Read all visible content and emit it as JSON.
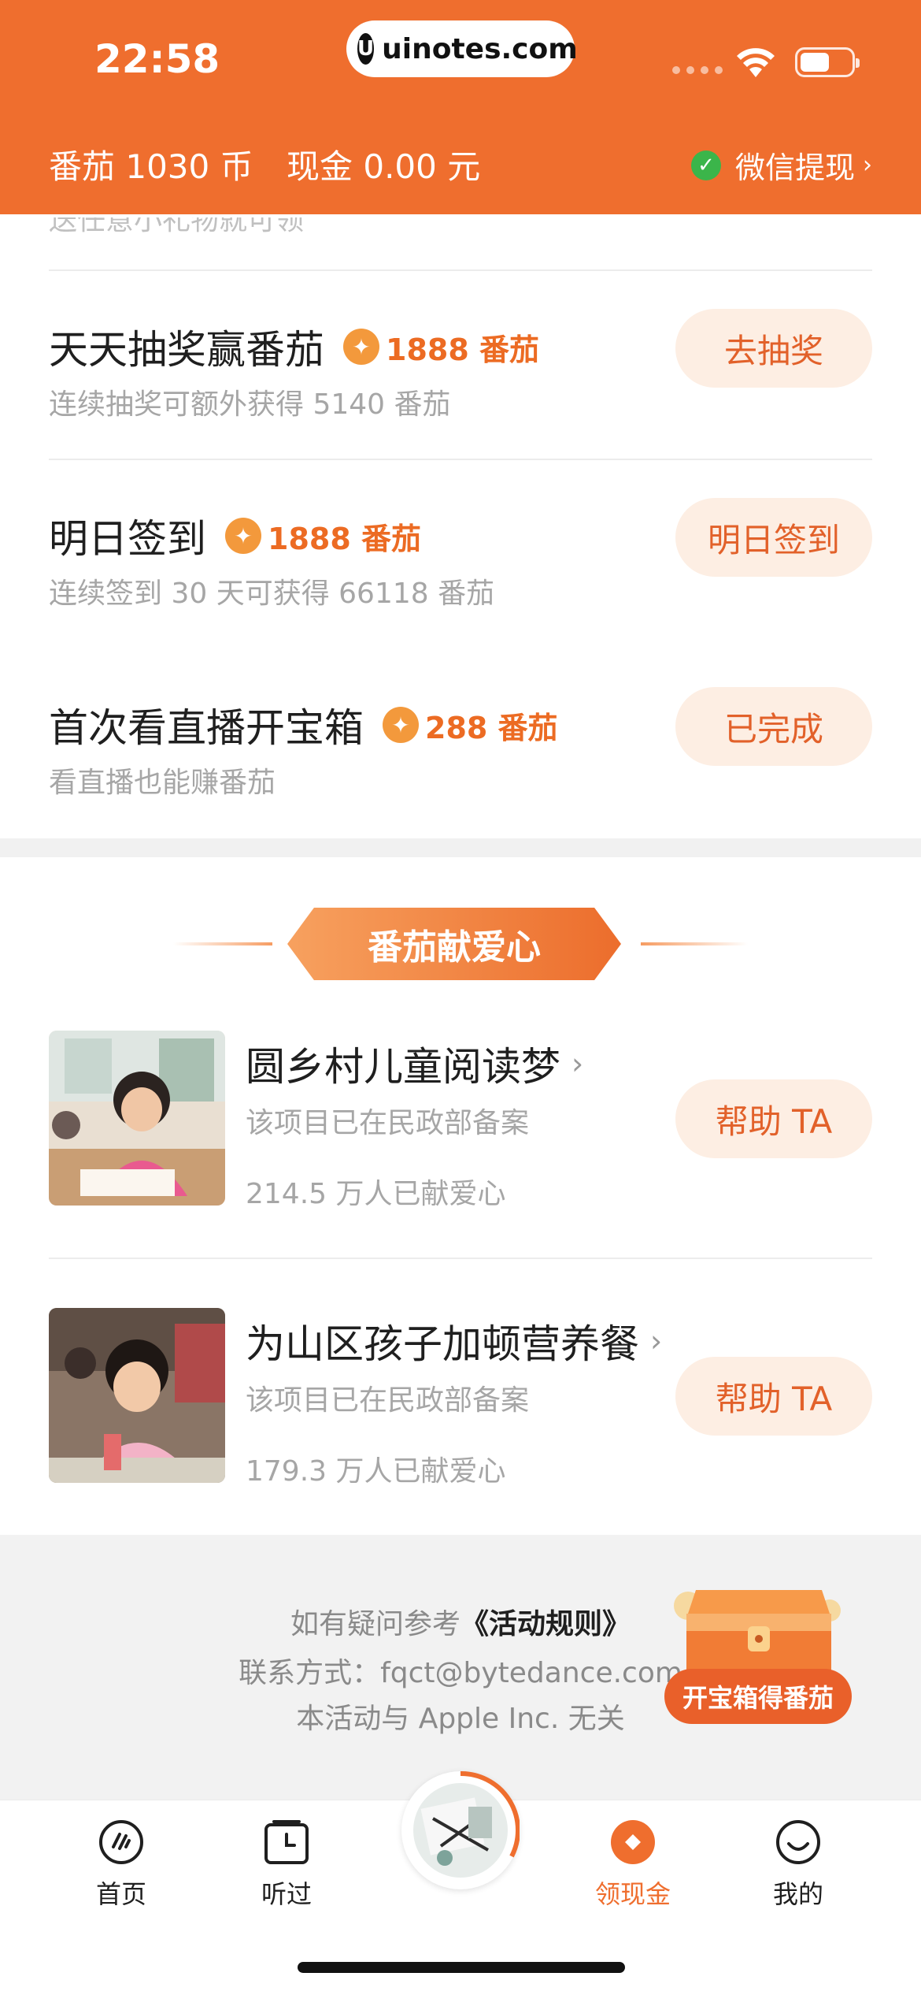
{
  "status_bar": {
    "time": "22:58",
    "url": "uinotes.com",
    "url_logo": "U"
  },
  "header": {
    "tomato_balance": "番茄 1030 币",
    "cash_balance": "现金 0.00 元",
    "wechat_withdraw": "微信提现",
    "chevron": "›"
  },
  "partial_text": "送任意小礼物就可领",
  "tasks": [
    {
      "title": "天天抽奖赢番茄",
      "reward": "1888 番茄",
      "subtitle": "连续抽奖可额外获得 5140 番茄",
      "button": "去抽奖"
    },
    {
      "title": "明日签到",
      "reward": "1888 番茄",
      "subtitle": "连续签到 30 天可获得 66118 番茄",
      "button": "明日签到"
    },
    {
      "title": "首次看直播开宝箱",
      "reward": "288 番茄",
      "subtitle": "看直播也能赚番茄",
      "button": "已完成"
    }
  ],
  "charity": {
    "heading": "番茄献爱心",
    "projects": [
      {
        "title": "圆乡村儿童阅读梦",
        "note": "该项目已在民政部备案",
        "count": "214.5 万人已献爱心",
        "button": "帮助 TA"
      },
      {
        "title": "为山区孩子加顿营养餐",
        "note": "该项目已在民政部备案",
        "count": "179.3 万人已献爱心",
        "button": "帮助 TA"
      }
    ],
    "chevron": "›"
  },
  "footer": {
    "rules_prefix": "如有疑问参考",
    "rules_link": "《活动规则》",
    "contact": "联系方式：fqct@bytedance.com",
    "disclaimer": "本活动与 Apple Inc. 无关",
    "chest_button": "开宝箱得番茄"
  },
  "tabbar": {
    "items": [
      {
        "label": "首页",
        "icon": "home-icon"
      },
      {
        "label": "听过",
        "icon": "history-icon"
      },
      {
        "label": "领现金",
        "icon": "cash-icon",
        "active": true
      },
      {
        "label": "我的",
        "icon": "profile-icon"
      }
    ]
  },
  "colors": {
    "brand": "#ef6e2e",
    "button_bg": "#fdeee3",
    "button_text": "#e2612a",
    "reward": "#ec6b23",
    "wechat_green": "#3bb54a"
  }
}
